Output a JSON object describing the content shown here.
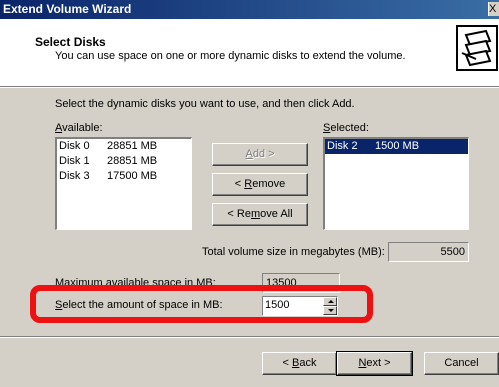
{
  "window": {
    "title": "Extend Volume Wizard",
    "close_glyph": "X"
  },
  "header": {
    "title": "Select Disks",
    "subtitle": "You can use space on one or more dynamic disks to extend the volume.",
    "icon": "wizard-disk-icon"
  },
  "instructions": "Select the dynamic disks you want to use, and then click Add.",
  "available": {
    "label_prefix": "",
    "label_accel": "A",
    "label_rest": "vailable:",
    "items": [
      {
        "disk": "Disk 0",
        "size": "28851 MB"
      },
      {
        "disk": "Disk 1",
        "size": "28851 MB"
      },
      {
        "disk": "Disk 3",
        "size": "17500 MB"
      }
    ]
  },
  "selected": {
    "label_accel": "S",
    "label_rest": "elected:",
    "items": [
      {
        "disk": "Disk 2",
        "size": "1500 MB"
      }
    ]
  },
  "buttons": {
    "add": {
      "accel": "A",
      "rest": "dd >"
    },
    "remove": {
      "pre": "< ",
      "accel": "R",
      "rest": "emove"
    },
    "remove_all": {
      "pre": "< Re",
      "accel": "m",
      "rest": "ove All"
    },
    "back": {
      "pre": "< ",
      "accel": "B",
      "rest": "ack"
    },
    "next": {
      "accel": "N",
      "rest": "ext >"
    },
    "cancel": "Cancel"
  },
  "total": {
    "label": "Total volume size in megabytes (MB):",
    "value": "5500"
  },
  "max": {
    "label": "Maximum available space in MB:",
    "value": "13500"
  },
  "amount": {
    "label_accel": "S",
    "label_rest": "elect the amount of space in MB:",
    "value": "1500"
  },
  "colors": {
    "highlight": "#ee1111",
    "selection": "#0a246a",
    "titlebar": "#0a246a"
  }
}
